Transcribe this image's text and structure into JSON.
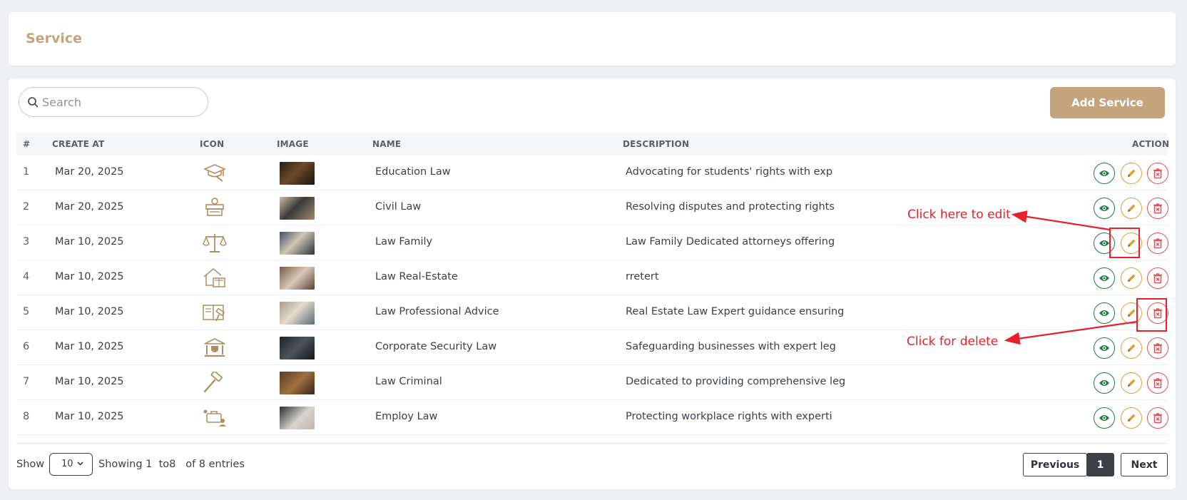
{
  "header": {
    "title": "Service"
  },
  "toolbar": {
    "search_placeholder": "Search",
    "search_value": "",
    "add_label": "Add Service"
  },
  "table": {
    "columns": [
      "#",
      "CREATE AT",
      "ICON",
      "IMAGE",
      "NAME",
      "DESCRIPTION",
      "ACTION"
    ],
    "rows": [
      {
        "idx": "1",
        "created": "Mar 20, 2025",
        "icon": "graduation-cap-icon",
        "name": "Education Law",
        "description": "Advocating for students' rights with exp"
      },
      {
        "idx": "2",
        "created": "Mar 20, 2025",
        "icon": "courtroom-judge-icon",
        "name": "Civil Law",
        "description": "Resolving disputes and protecting rights"
      },
      {
        "idx": "3",
        "created": "Mar 10, 2025",
        "icon": "scales-of-justice-icon",
        "name": "Law Family",
        "description": "Law Family Dedicated attorneys offering"
      },
      {
        "idx": "4",
        "created": "Mar 10, 2025",
        "icon": "house-law-icon",
        "name": "Law Real-Estate",
        "description": "rretert"
      },
      {
        "idx": "5",
        "created": "Mar 10, 2025",
        "icon": "law-book-icon",
        "name": "Law Professional Advice",
        "description": "Real Estate Law Expert guidance ensuring"
      },
      {
        "idx": "6",
        "created": "Mar 10, 2025",
        "icon": "courthouse-shield-icon",
        "name": "Corporate Security Law",
        "description": "Safeguarding businesses with expert leg"
      },
      {
        "idx": "7",
        "created": "Mar 10, 2025",
        "icon": "gavel-icon",
        "name": "Law Criminal",
        "description": "Dedicated to providing comprehensive leg"
      },
      {
        "idx": "8",
        "created": "Mar 10, 2025",
        "icon": "briefcase-people-icon",
        "name": "Employ Law",
        "description": "Protecting workplace rights with experti"
      }
    ]
  },
  "footer": {
    "show_label": "Show",
    "page_size": "10",
    "showing_text": "Showing 1  to8   of 8 entries",
    "prev_label": "Previous",
    "page_current": "1",
    "next_label": "Next"
  },
  "annotations": {
    "edit_text": "Click here to edit",
    "delete_text": "Click for delete"
  },
  "colors": {
    "brand": "#c4a47c",
    "view": "#1e7a45",
    "edit": "#d9a03a",
    "delete": "#e0505a",
    "annotation": "#e8202a"
  }
}
